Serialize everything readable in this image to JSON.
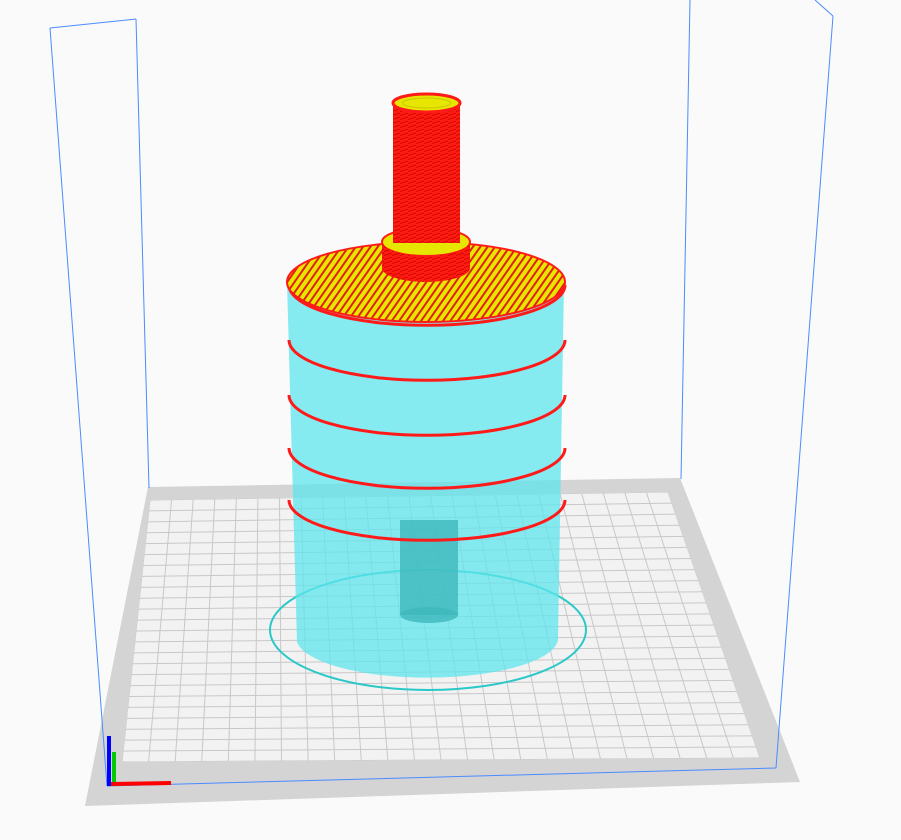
{
  "viewport": {
    "type": "3d-slice-preview",
    "colors": {
      "background": "#fafafa",
      "plate_border": "#d4d4d4",
      "plate_surface": "#f2f2f2",
      "grid": "#c8c8c8",
      "bounding_box": "#4a8cff",
      "model_shell": "#5fe6ec",
      "wall_line": "#ff1a1a",
      "infill": "#e6e600",
      "skirt": "#2ac8c8",
      "axis_x": "#ff0000",
      "axis_y": "#00cc00",
      "axis_z": "#0000ff"
    }
  }
}
